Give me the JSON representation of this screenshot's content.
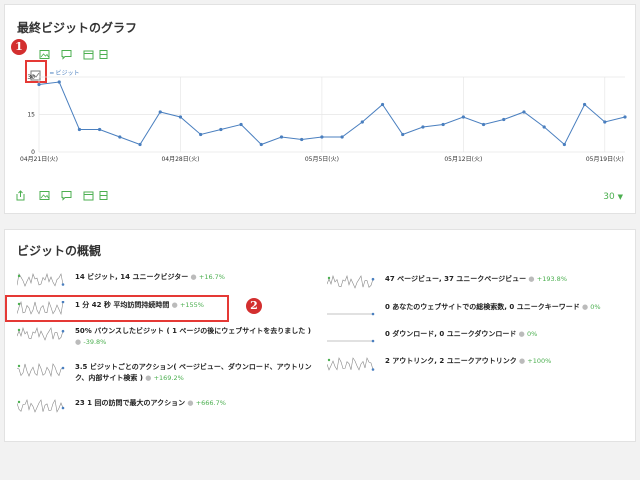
{
  "visits_chart": {
    "title": "最終ビジットのグラフ",
    "legend_label": "ビジット",
    "period_value": "30",
    "marker_number": "1",
    "toolbar_icons": [
      "chart-icon",
      "image-icon",
      "comment-icon",
      "calendar-icon",
      "calendar-icon"
    ],
    "bottom_icons": [
      "export-icon",
      "image-icon",
      "comment-icon",
      "calendar-icon",
      "calendar-icon"
    ]
  },
  "chart_data": {
    "type": "line",
    "title": "",
    "xlabel": "",
    "ylabel": "",
    "ylim": [
      0,
      30
    ],
    "yticks": [
      "0",
      "15",
      "30"
    ],
    "xtick_labels": [
      "04月21日(火)",
      "04月28日(火)",
      "05月5日(火)",
      "05月12日(火)",
      "05月19日(火)"
    ],
    "x": [
      "2015-04-21",
      "2015-04-22",
      "2015-04-23",
      "2015-04-24",
      "2015-04-25",
      "2015-04-26",
      "2015-04-27",
      "2015-04-28",
      "2015-04-29",
      "2015-04-30",
      "2015-05-01",
      "2015-05-02",
      "2015-05-03",
      "2015-05-04",
      "2015-05-05",
      "2015-05-06",
      "2015-05-07",
      "2015-05-08",
      "2015-05-09",
      "2015-05-10",
      "2015-05-11",
      "2015-05-12",
      "2015-05-13",
      "2015-05-14",
      "2015-05-15",
      "2015-05-16",
      "2015-05-17",
      "2015-05-18",
      "2015-05-19",
      "2015-05-20"
    ],
    "series": [
      {
        "name": "ビジット",
        "values": [
          27,
          28,
          9,
          9,
          6,
          3,
          16,
          14,
          7,
          9,
          11,
          3,
          6,
          5,
          6,
          6,
          12,
          19,
          7,
          10,
          11,
          14,
          11,
          13,
          16,
          10,
          3,
          19,
          12,
          14
        ]
      }
    ],
    "color": "#4a7fbf",
    "grid": true
  },
  "overview": {
    "title": "ビジットの概観",
    "marker_number": "2",
    "left": [
      {
        "main": "14 ビジット, 14 ユニークビジター",
        "delta": "+16.7%"
      },
      {
        "main": "1 分 42 秒 平均訪問持続時間",
        "delta": "+155%"
      },
      {
        "main": "50% バウンスしたビジット ( 1 ページの後にウェブサイトを去りました )",
        "delta": "-39.8%"
      },
      {
        "main": "3.5 ビジットごとのアクション( ページビュー、ダウンロード、アウトリンク、内部サイト検索 )",
        "delta": "+169.2%"
      },
      {
        "main": "23 1 回の訪問で最大のアクション",
        "delta": "+666.7%"
      }
    ],
    "right": [
      {
        "main": "47 ページビュー, 37 ユニークページビュー",
        "delta": "+193.8%"
      },
      {
        "main": "0 あなたのウェブサイトでの総検索数, 0 ユニークキーワード",
        "delta": "0%"
      },
      {
        "main": "0 ダウンロード, 0 ユニークダウンロード",
        "delta": "0%"
      },
      {
        "main": "2 アウトリンク, 2 ユニークアウトリンク",
        "delta": "+100%"
      }
    ]
  }
}
